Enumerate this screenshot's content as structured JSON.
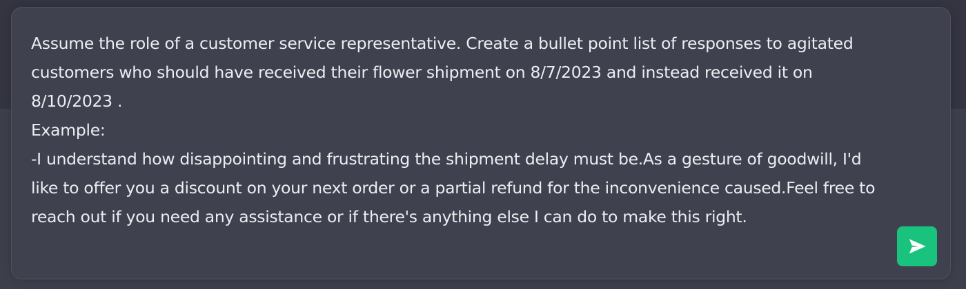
{
  "composer": {
    "text": "Assume the role of a customer service representative. Create a bullet point list of responses to agitated customers who should have received their flower shipment on 8/7/2023 and instead received it on 8/10/2023 .\nExample:\n-I understand how disappointing and frustrating the shipment delay must be.As a gesture of goodwill, I'd like to offer you a discount on your next order or a partial refund for the inconvenience caused.Feel free to reach out if you need any assistance or if there's anything else I can do to make this right.",
    "send_icon": "send-icon"
  },
  "colors": {
    "page_background": "#343541",
    "lower_background": "#3d3f4b",
    "composer_background": "#40414f",
    "text": "#ececf1",
    "send_button": "#19c37d"
  }
}
